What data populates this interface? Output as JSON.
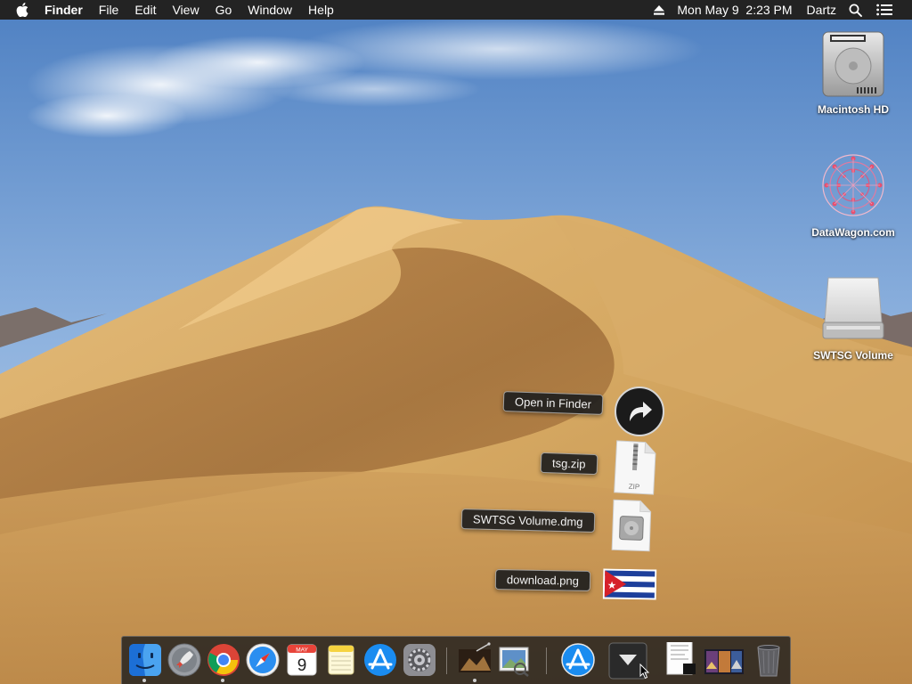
{
  "menubar": {
    "apple_icon": "apple-logo-icon",
    "app_name": "Finder",
    "menus": [
      "File",
      "Edit",
      "View",
      "Go",
      "Window",
      "Help"
    ],
    "datetime": "Mon May 9  2:23 PM",
    "user": "Dartz",
    "status_icons": [
      "eject-icon",
      "spotlight-search-icon",
      "notification-center-icon"
    ]
  },
  "desktop_icons": [
    {
      "label": "Macintosh HD",
      "icon": "hard-drive-icon"
    },
    {
      "label": "DataWagon.com",
      "icon": "datawagon-disk-icon"
    },
    {
      "label": "SWTSG Volume",
      "icon": "mounted-volume-icon"
    }
  ],
  "stack_fan": {
    "open_label": "Open in Finder",
    "items": [
      {
        "label": "tsg.zip",
        "icon": "zip-file-icon",
        "badge": "ZIP"
      },
      {
        "label": "SWTSG Volume.dmg",
        "icon": "dmg-file-icon"
      },
      {
        "label": "download.png",
        "icon": "cuba-flag-image-icon"
      }
    ]
  },
  "dock": {
    "apps": [
      {
        "name": "finder-icon",
        "running": true
      },
      {
        "name": "launchpad-icon",
        "running": false
      },
      {
        "name": "chrome-icon",
        "running": true
      },
      {
        "name": "safari-icon",
        "running": false
      },
      {
        "name": "calendar-icon",
        "running": false,
        "month": "MAY",
        "day": "9"
      },
      {
        "name": "notes-icon",
        "running": false
      },
      {
        "name": "app-store-icon",
        "running": false
      },
      {
        "name": "system-preferences-icon",
        "running": false
      },
      {
        "name": "screen-recording-icon",
        "running": true
      },
      {
        "name": "preview-icon",
        "running": false
      },
      {
        "name": "app-store-downloads-icon",
        "running": false
      },
      {
        "name": "downloads-stack-icon",
        "running": false
      },
      {
        "name": "documents-stack-icon",
        "running": false
      },
      {
        "name": "photos-folder-icon",
        "running": false
      },
      {
        "name": "trash-icon",
        "running": false
      }
    ]
  },
  "colors": {
    "menubar_bg": "#232323",
    "dock_bg": "#1e1e1e",
    "sand": "#d2a562",
    "sky": "#6d9bd6"
  }
}
